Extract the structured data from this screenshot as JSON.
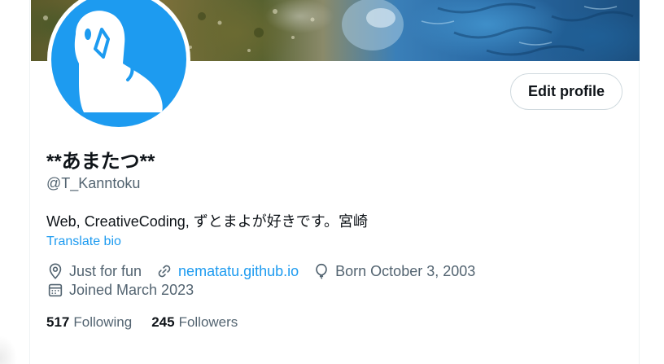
{
  "profile": {
    "display_name": "**あまたつ**",
    "handle": "@T_Kanntoku",
    "bio": "Web, CreativeCoding, ずとまよが好きです。宮崎",
    "translate_bio": "Translate bio",
    "edit_profile": "Edit profile",
    "avatar_color": "#1d9bf0"
  },
  "meta": {
    "category": "Just for fun",
    "website": "nematatu.github.io",
    "birthday": "Born October 3, 2003",
    "joined": "Joined March 2023",
    "icons": [
      "location-icon",
      "link-icon",
      "balloon-icon",
      "calendar-icon"
    ]
  },
  "stats": {
    "following_count": "517",
    "following_label": "Following",
    "followers_count": "245",
    "followers_label": "Followers"
  },
  "colors": {
    "accent": "#1d9bf0",
    "text": "#0f1419",
    "secondary": "#536471",
    "border": "#cfd9de"
  }
}
